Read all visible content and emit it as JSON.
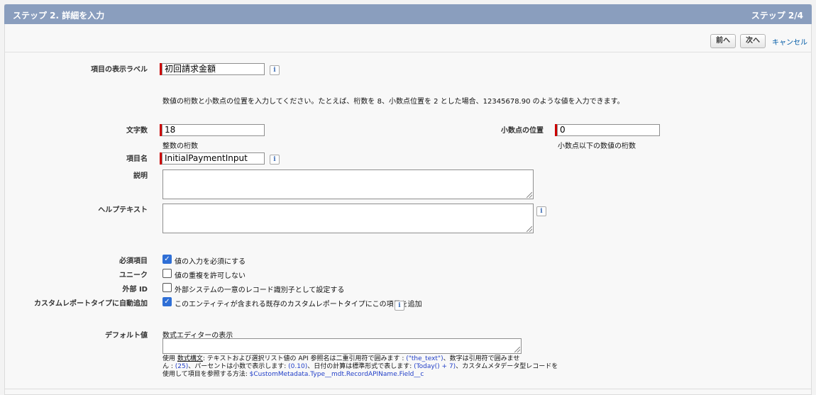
{
  "header": {
    "title": "ステップ 2. 詳細を入力",
    "step": "ステップ 2/4"
  },
  "toolbar": {
    "prev": "前へ",
    "next": "次へ",
    "cancel": "キャンセル"
  },
  "form": {
    "label_field": {
      "label": "項目の表示ラベル",
      "value": "初回請求金額"
    },
    "instruction": "数値の桁数と小数点の位置を入力してください。たとえば、桁数を 8、小数点位置を 2 とした場合、12345678.90 のような値を入力できます。",
    "length": {
      "label": "文字数",
      "value": "18",
      "hint": "整数の桁数"
    },
    "decimal": {
      "label": "小数点の位置",
      "value": "0",
      "hint": "小数点以下の数値の桁数"
    },
    "api_name": {
      "label": "項目名",
      "value": "InitialPaymentInput"
    },
    "description": {
      "label": "説明"
    },
    "help_text": {
      "label": "ヘルプテキスト"
    },
    "required": {
      "label": "必須項目",
      "text": "値の入力を必須にする",
      "checked": true
    },
    "unique": {
      "label": "ユニーク",
      "text": "値の重複を許可しない",
      "checked": false
    },
    "external_id": {
      "label": "外部 ID",
      "text": "外部システムの一意のレコード識別子として設定する",
      "checked": false
    },
    "report_type": {
      "label": "カスタムレポートタイプに自動追加",
      "text": "このエンティティが含まれる既存のカスタムレポートタイプにこの項目を追加",
      "checked": true
    },
    "default_value": {
      "label": "デフォルト値",
      "formula_link": "数式エディターの表示",
      "help_use": "使用",
      "help_syntax": "数式構文",
      "help_1": ": テキストおよび選択リスト値の API 参照名は二重引用符で囲みます : ",
      "help_ex1": "(\"the_text\")",
      "help_2": "、数字は引用符で囲みませ",
      "help_3": "ん : ",
      "help_ex2": "(25)",
      "help_4": "、パーセントは小数で表示します: ",
      "help_ex3": "(0.10)",
      "help_5": "、日付の計算は標準形式で表します: ",
      "help_ex4": "(Today() + 7)",
      "help_6": "、カスタムメタデータ型レコードを",
      "help_7": "使用して項目を参照する方法: ",
      "help_ex5": "$CustomMetadata.Type__mdt.RecordAPIName.Field__c"
    },
    "info_icon": "i",
    "check_glyph": "✓"
  }
}
